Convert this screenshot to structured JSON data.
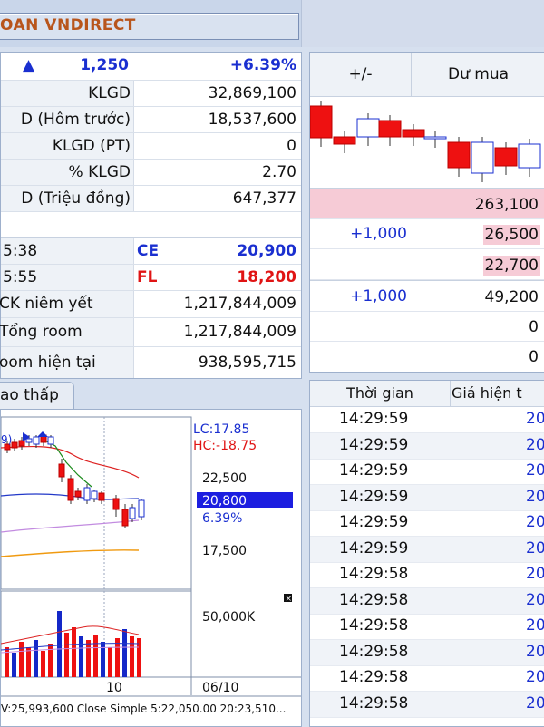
{
  "header": {
    "title": "OAN VNDIRECT"
  },
  "summary": {
    "arrow": "▲",
    "change": "1,250",
    "percent": "+6.39%",
    "rows": [
      {
        "label": "KLGD",
        "value": "32,869,100"
      },
      {
        "label": "D (Hôm trước)",
        "value": "18,537,600"
      },
      {
        "label": "KLGD (PT)",
        "value": "0"
      },
      {
        "label": "% KLGD",
        "value": "2.70"
      },
      {
        "label": "D (Triệu đồng)",
        "value": "647,377"
      }
    ],
    "ce": {
      "time": "5:38",
      "label": "CE",
      "value": "20,900"
    },
    "fl": {
      "time": "5:55",
      "label": "FL",
      "value": "18,200"
    },
    "room": [
      {
        "label": "CK niêm yết",
        "value": "1,217,844,009"
      },
      {
        "label": "Tổng room",
        "value": "1,217,844,009"
      },
      {
        "label": "oom hiện tại",
        "value": "938,595,715"
      }
    ]
  },
  "orderbook": {
    "headers": [
      "+/-",
      "Dư mua"
    ],
    "rows": [
      {
        "diff": "",
        "value": "263,100",
        "pink": true
      },
      {
        "diff": "+1,000",
        "value": "26,500",
        "pink": true
      },
      {
        "diff": "",
        "value": "22,700",
        "pink": true
      },
      {
        "diff": "+1,000",
        "value": "49,200",
        "pink": false
      },
      {
        "diff": "",
        "value": "0",
        "pink": false
      },
      {
        "diff": "",
        "value": "0",
        "pink": false
      }
    ]
  },
  "tab": {
    "label": "ao thấp"
  },
  "chart_data": {
    "type": "candlestick",
    "price_labels": {
      "lc": "LC:17.85",
      "hc": "HC:-18.75",
      "current": "20,800",
      "current_pct": "6.39%"
    },
    "y_ticks": [
      "22,500",
      "17,500"
    ],
    "volume_tick": "50,000K",
    "x_ticks": [
      "10",
      "06/10"
    ],
    "legend_top": "9)",
    "footer": "V:25,993,600  Close Simple 5:22,050.00  20:23,510..."
  },
  "trades": {
    "headers": [
      "Thời gian",
      "Giá hiện t"
    ],
    "rows": [
      {
        "time": "14:29:59",
        "price": "20"
      },
      {
        "time": "14:29:59",
        "price": "20"
      },
      {
        "time": "14:29:59",
        "price": "20"
      },
      {
        "time": "14:29:59",
        "price": "20"
      },
      {
        "time": "14:29:59",
        "price": "20"
      },
      {
        "time": "14:29:59",
        "price": "20"
      },
      {
        "time": "14:29:58",
        "price": "20"
      },
      {
        "time": "14:29:58",
        "price": "20"
      },
      {
        "time": "14:29:58",
        "price": "20"
      },
      {
        "time": "14:29:58",
        "price": "20"
      },
      {
        "time": "14:29:58",
        "price": "20"
      },
      {
        "time": "14:29:58",
        "price": "20"
      }
    ]
  }
}
